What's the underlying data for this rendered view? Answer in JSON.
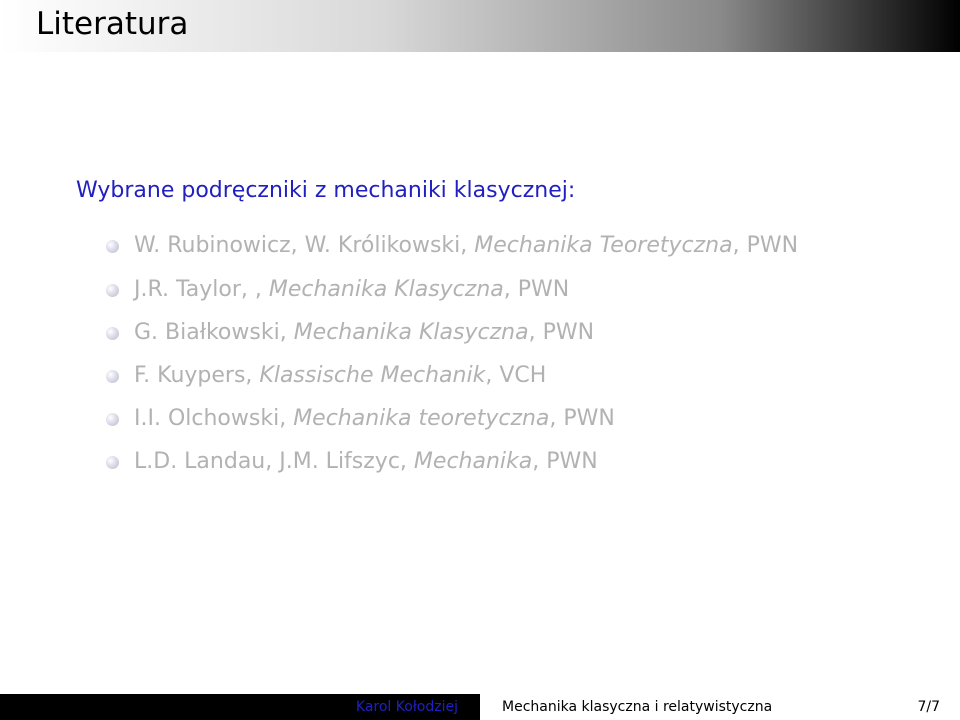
{
  "frame": {
    "title": "Literatura"
  },
  "content": {
    "heading": "Wybrane podręczniki z mechaniki klasycznej:",
    "items": [
      {
        "authors": "W. Rubinowicz, W. Królikowski, ",
        "title": "Mechanika Teoretyczna",
        "publisher": ", PWN"
      },
      {
        "authors": "J.R. Taylor, , ",
        "title": "Mechanika Klasyczna",
        "publisher": ", PWN"
      },
      {
        "authors": "G. Białkowski, ",
        "title": "Mechanika Klasyczna",
        "publisher": ", PWN"
      },
      {
        "authors": "F. Kuypers, ",
        "title": "Klassische Mechanik",
        "publisher": ", VCH"
      },
      {
        "authors": "I.I. Olchowski, ",
        "title": "Mechanika teoretyczna",
        "publisher": ", PWN"
      },
      {
        "authors": "L.D. Landau, J.M. Lifszyc, ",
        "title": "Mechanika",
        "publisher": ", PWN"
      }
    ]
  },
  "footer": {
    "author": "Karol Kołodziej",
    "title": "Mechanika klasyczna i relatywistyczna",
    "page": "7/7"
  },
  "colors": {
    "heading": "#2020c0",
    "inactive_text": "#b2b2b2",
    "footer_author_bg": "#000000",
    "footer_author_text": "#2020c0"
  },
  "icons": {
    "bullet": "sphere-bullet-icon"
  }
}
